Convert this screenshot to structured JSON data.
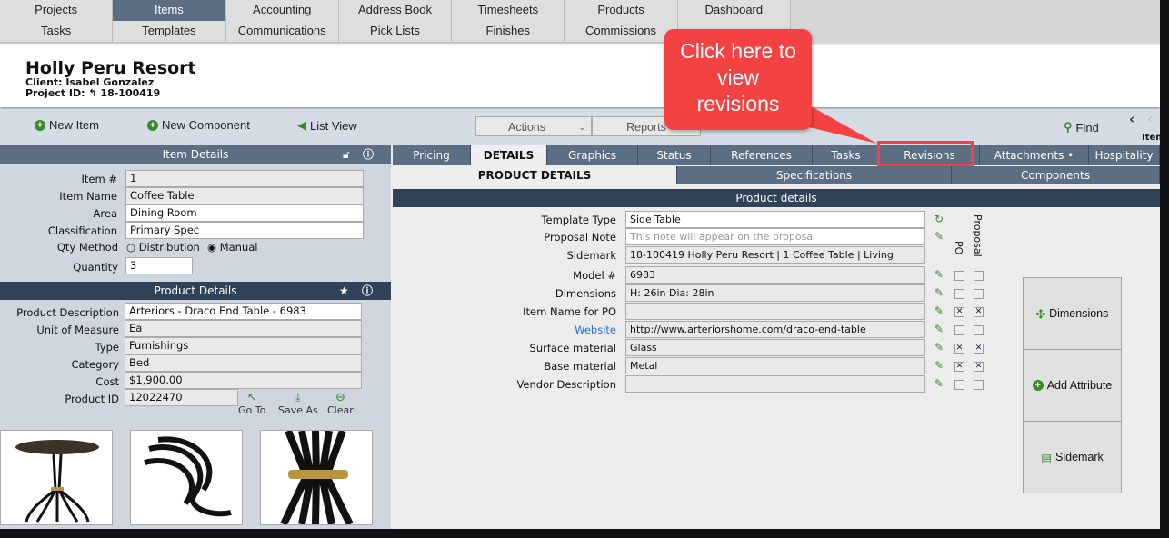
{
  "nav": {
    "row1": [
      "Projects",
      "Items",
      "Accounting",
      "Address Book",
      "Timesheets",
      "Products",
      "Dashboard"
    ],
    "row2": [
      "Tasks",
      "Templates",
      "Communications",
      "Pick Lists",
      "Finishes",
      "Commissions",
      ""
    ],
    "active": "Items"
  },
  "header": {
    "title": "Holly Peru Resort",
    "client": "Client: Isabel Gonzalez",
    "project_id_label": "Project ID:",
    "project_id": "18-100419"
  },
  "toolbar": {
    "new_item": "New Item",
    "new_component": "New Component",
    "list_view": "List View",
    "actions": "Actions",
    "reports": "Reports",
    "find": "Find",
    "item_label": "Item"
  },
  "item_details": {
    "title": "Item Details",
    "fields": [
      {
        "label": "Item #",
        "value": "1"
      },
      {
        "label": "Item Name",
        "value": "Coffee Table"
      },
      {
        "label": "Area",
        "value": "Dining Room"
      },
      {
        "label": "Classification",
        "value": "Primary Spec"
      }
    ],
    "qty_method_label": "Qty Method",
    "qty_options": [
      "Distribution",
      "Manual"
    ],
    "qty_selected": "Manual",
    "quantity_label": "Quantity",
    "quantity": "3"
  },
  "product_details_left": {
    "title": "Product Details",
    "fields": [
      {
        "label": "Product Description",
        "value": "Arteriors - Draco End Table - 6983"
      },
      {
        "label": "Unit of Measure",
        "value": "Ea"
      },
      {
        "label": "Type",
        "value": "Furnishings"
      },
      {
        "label": "Category",
        "value": "Bed"
      },
      {
        "label": "Cost",
        "value": "$1,900.00"
      },
      {
        "label": "Product ID",
        "value": "12022470"
      }
    ],
    "go_to": "Go To",
    "save_as": "Save As",
    "clear": "Clear"
  },
  "tabs": [
    "Pricing",
    "DETAILS",
    "Graphics",
    "Status",
    "References",
    "Tasks",
    "Revisions",
    "Attachments •",
    "Hospitality"
  ],
  "active_tab": "DETAILS",
  "subtabs": [
    "PRODUCT DETAILS",
    "Specifications",
    "Components"
  ],
  "product_details": {
    "title": "Product details",
    "col_po": "PO",
    "col_proposal": "Proposal",
    "rows": [
      {
        "label": "Template Type",
        "value": "Side Table",
        "placeholder": ""
      },
      {
        "label": "Proposal Note",
        "value": "",
        "placeholder": "This note will appear on the proposal"
      },
      {
        "label": "Sidemark",
        "value": "18-100419 Holly Peru Resort | 1 Coffee Table | Living"
      },
      {
        "label": "Model #",
        "value": "6983",
        "po": false,
        "proposal": false
      },
      {
        "label": "Dimensions",
        "value": "H: 26in  Dia: 28in",
        "po": false,
        "proposal": false
      },
      {
        "label": "Item Name for PO",
        "value": "",
        "po": true,
        "proposal": true
      },
      {
        "label": "Website",
        "value": "http://www.arteriorshome.com/draco-end-table",
        "po": false,
        "proposal": false,
        "link": true
      },
      {
        "label": "Surface material",
        "value": "Glass",
        "po": true,
        "proposal": true
      },
      {
        "label": "Base material",
        "value": "Metal",
        "po": true,
        "proposal": true
      },
      {
        "label": "Vendor Description",
        "value": "",
        "po": false,
        "proposal": false
      }
    ]
  },
  "side_buttons": [
    "Dimensions",
    "Add Attribute",
    "Sidemark"
  ],
  "callout": {
    "text": "Click here to view revisions",
    "color": "#f44242"
  },
  "colors": {
    "nav_active": "#5b6e84",
    "dark_bar": "#2f4257",
    "green_icon": "#3a8a2a",
    "link": "#2a6fd6"
  }
}
